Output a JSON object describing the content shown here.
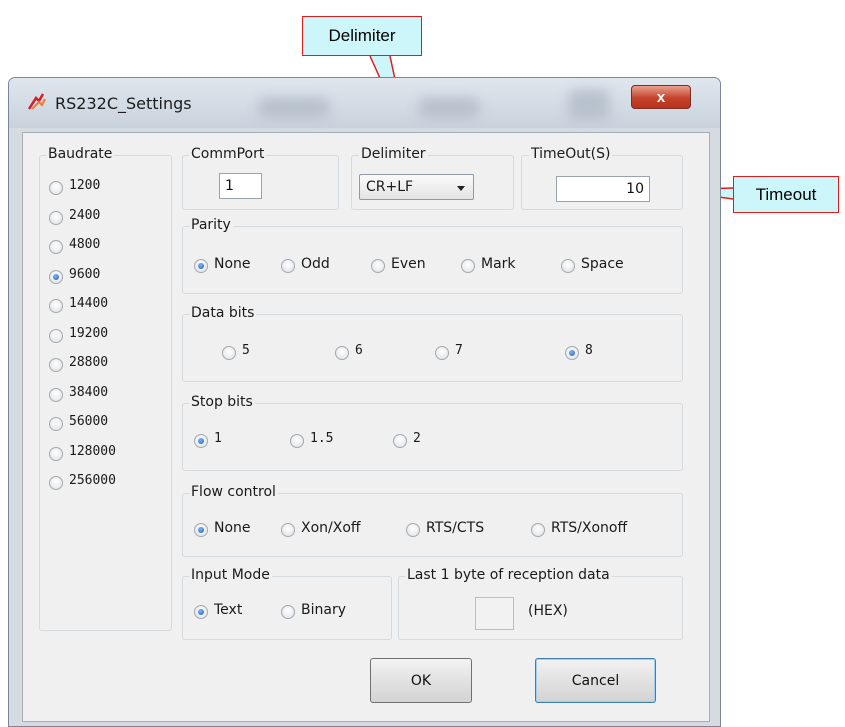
{
  "callouts": {
    "delimiter": "Delimiter",
    "timeout": "Timeout"
  },
  "window": {
    "title": "RS232C_Settings",
    "close_glyph": "x"
  },
  "baudrate": {
    "label": "Baudrate",
    "options": [
      "1200",
      "2400",
      "4800",
      "9600",
      "14400",
      "19200",
      "28800",
      "38400",
      "56000",
      "128000",
      "256000"
    ],
    "selected": "9600"
  },
  "commport": {
    "label": "CommPort",
    "value": "1"
  },
  "delimiter": {
    "label": "Delimiter",
    "value": "CR+LF"
  },
  "timeout": {
    "label": "TimeOut(S)",
    "value": "10"
  },
  "parity": {
    "label": "Parity",
    "options": [
      "None",
      "Odd",
      "Even",
      "Mark",
      "Space"
    ],
    "selected": "None"
  },
  "databits": {
    "label": "Data bits",
    "options": [
      "5",
      "6",
      "7",
      "8"
    ],
    "selected": "8"
  },
  "stopbits": {
    "label": "Stop bits",
    "options": [
      "1",
      "1.5",
      "2"
    ],
    "selected": "1"
  },
  "flowcontrol": {
    "label": "Flow control",
    "options": [
      "None",
      "Xon/Xoff",
      "RTS/CTS",
      "RTS/Xonoff"
    ],
    "selected": "None"
  },
  "inputmode": {
    "label": "Input Mode",
    "options": [
      "Text",
      "Binary"
    ],
    "selected": "Text"
  },
  "lastbyte": {
    "label": "Last 1 byte of reception data",
    "value": "",
    "unit": "(HEX)"
  },
  "buttons": {
    "ok": "OK",
    "cancel": "Cancel"
  },
  "colors": {
    "callout_bg": "#cdf6fb",
    "callout_border": "#e21b1b",
    "window_bg": "#f0f0f0",
    "radio_selected": "#1f5ec9"
  }
}
